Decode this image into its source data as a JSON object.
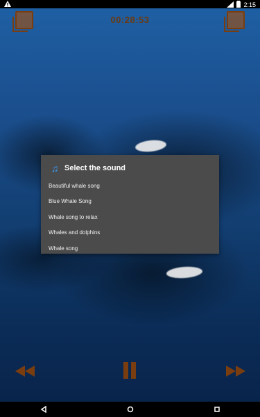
{
  "status": {
    "time": "2:15",
    "warning_icon": "warning-icon",
    "signal_icon": "signal-icon",
    "battery_icon": "battery-icon"
  },
  "header": {
    "timer": "00:28:53",
    "left_icon": "playlist-icon",
    "right_icon": "playlist-add-icon"
  },
  "dialog": {
    "title": "Select the sound",
    "icon": "music-note-icon",
    "items": [
      {
        "label": "Beautiful whale song"
      },
      {
        "label": "Blue Whale Song"
      },
      {
        "label": "Whale song to relax"
      },
      {
        "label": "Whales and dolphins"
      },
      {
        "label": "Whale song"
      }
    ]
  },
  "controls": {
    "rewind_icon": "rewind-icon",
    "pause_icon": "pause-icon",
    "fast_forward_icon": "fast-forward-icon"
  },
  "navigation": {
    "back_icon": "back-icon",
    "home_icon": "home-icon",
    "recents_icon": "recents-icon"
  }
}
